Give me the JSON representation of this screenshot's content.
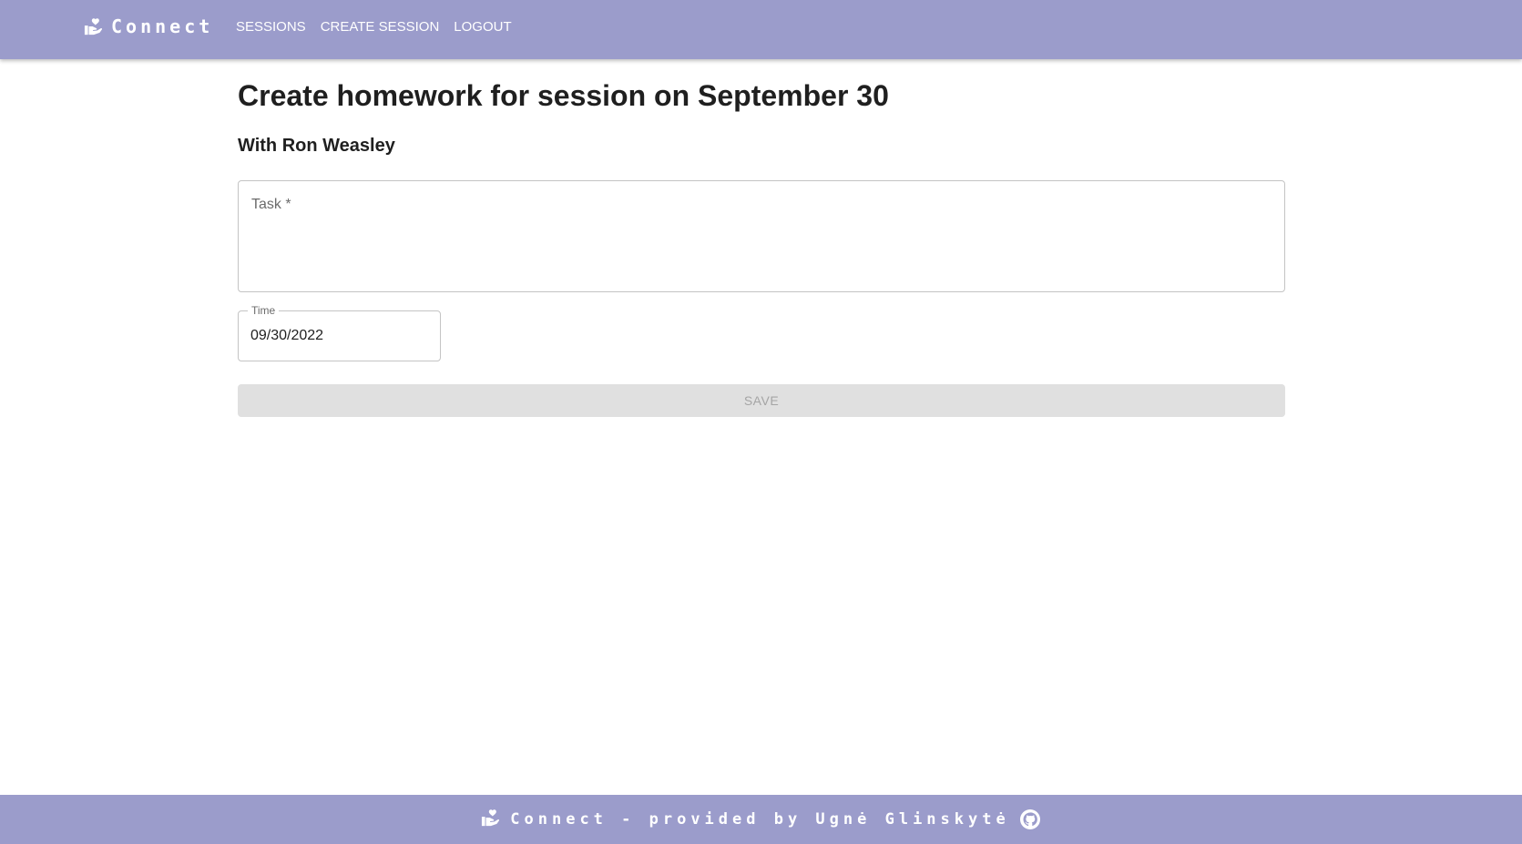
{
  "header": {
    "brand_name": "Connect",
    "nav": [
      {
        "label": "SESSIONS"
      },
      {
        "label": "CREATE SESSION"
      },
      {
        "label": "LOGOUT"
      }
    ]
  },
  "page": {
    "title": "Create homework for session on September 30",
    "subtitle": "With Ron Weasley"
  },
  "form": {
    "task_label": "Task *",
    "task_value": "",
    "time_label": "Time",
    "time_value": "09/30/2022",
    "save_label": "SAVE",
    "save_disabled": true
  },
  "footer": {
    "text": "Connect - provided by Ugnė Glinskytė",
    "github_icon": "github-icon"
  },
  "colors": {
    "appbar": "#9b9ccb",
    "disabled_button_bg": "#e0e0e0",
    "disabled_button_text": "#a5a5a5"
  }
}
